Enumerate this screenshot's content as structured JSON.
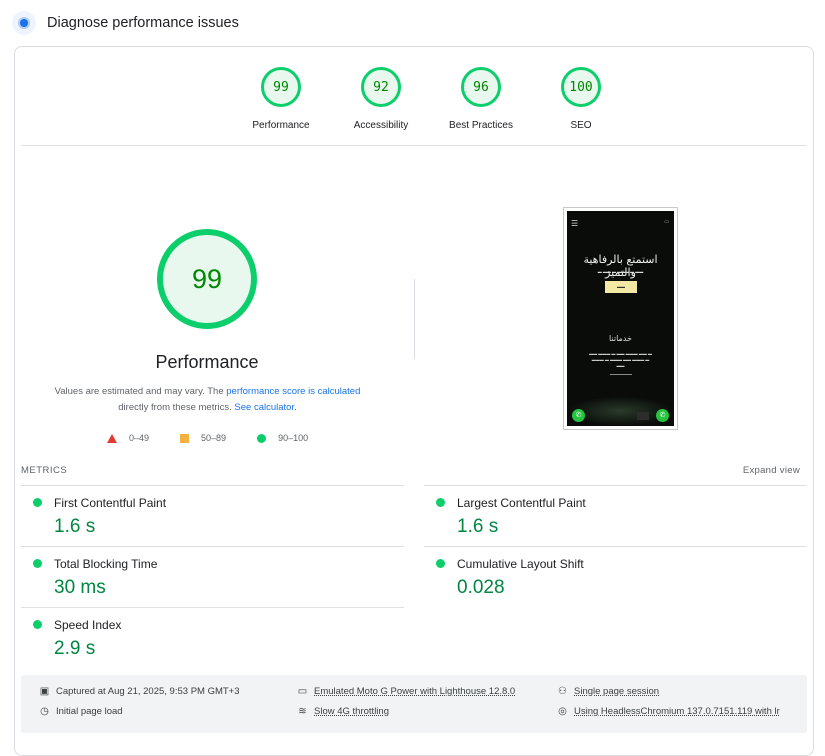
{
  "header": {
    "title": "Diagnose performance issues",
    "icon": "pagespeed-logo-icon"
  },
  "categories": [
    {
      "score": "99",
      "label": "Performance"
    },
    {
      "score": "92",
      "label": "Accessibility"
    },
    {
      "score": "96",
      "label": "Best Practices"
    },
    {
      "score": "100",
      "label": "SEO"
    }
  ],
  "performance": {
    "score": "99",
    "title": "Performance",
    "note_pre": "Values are estimated and may vary. The ",
    "note_link1": "performance score is calculated",
    "note_mid": "directly from these metrics. ",
    "note_link2": "See calculator."
  },
  "legend": [
    {
      "range": "0–49",
      "color": "#e53935"
    },
    {
      "range": "50–89",
      "color": "#f4b13f"
    },
    {
      "range": "90–100",
      "color": "#0cce6b"
    }
  ],
  "screenshot": {
    "hero": "استمتع بالرفاهية والتميز",
    "section": "خدماتنا"
  },
  "metrics": {
    "heading": "METRICS",
    "expand": "Expand view",
    "items": [
      {
        "name": "First Contentful Paint",
        "value": "1.6 s"
      },
      {
        "name": "Largest Contentful Paint",
        "value": "1.6 s"
      },
      {
        "name": "Total Blocking Time",
        "value": "30 ms"
      },
      {
        "name": "Cumulative Layout Shift",
        "value": "0.028"
      },
      {
        "name": "Speed Index",
        "value": "2.9 s"
      }
    ]
  },
  "footer": {
    "captured": "Captured at Aug 21, 2025, 9:53 PM GMT+3",
    "initial": "Initial page load",
    "device": "Emulated Moto G Power with Lighthouse 12.8.0",
    "throttling": "Slow 4G throttling",
    "session": "Single page session",
    "browser": "Using HeadlessChromium 137.0.7151.119 with lr"
  },
  "colors": {
    "pass": "#0cce6b",
    "pass_text": "#018642",
    "link": "#1a73e8"
  }
}
